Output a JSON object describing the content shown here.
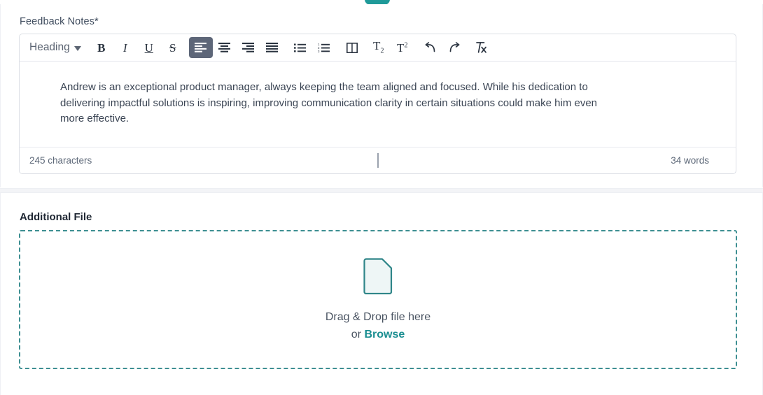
{
  "feedback_section": {
    "label": "Feedback Notes*",
    "toolbar": {
      "heading_label": "Heading",
      "caret_icon": "chevron-down-icon",
      "buttons": [
        {
          "name": "bold",
          "glyph": "B",
          "icon": "bold-icon"
        },
        {
          "name": "italic",
          "glyph": "I",
          "icon": "italic-icon"
        },
        {
          "name": "underline",
          "glyph": "U",
          "icon": "underline-icon"
        },
        {
          "name": "strikethrough",
          "glyph": "S",
          "icon": "strikethrough-icon"
        },
        {
          "name": "align-left",
          "glyph": "",
          "icon": "align-left-icon",
          "active": true
        },
        {
          "name": "align-center",
          "glyph": "",
          "icon": "align-center-icon"
        },
        {
          "name": "align-right",
          "glyph": "",
          "icon": "align-right-icon"
        },
        {
          "name": "align-justify",
          "glyph": "",
          "icon": "align-justify-icon"
        },
        {
          "name": "bullet-list",
          "glyph": "",
          "icon": "bulleted-list-icon"
        },
        {
          "name": "numbered-list",
          "glyph": "",
          "icon": "numbered-list-icon"
        },
        {
          "name": "columns",
          "glyph": "",
          "icon": "columns-icon"
        },
        {
          "name": "subscript",
          "glyph": "T2",
          "icon": "subscript-icon"
        },
        {
          "name": "superscript",
          "glyph": "T2",
          "icon": "superscript-icon"
        },
        {
          "name": "undo",
          "glyph": "",
          "icon": "undo-icon"
        },
        {
          "name": "redo",
          "glyph": "",
          "icon": "redo-icon"
        },
        {
          "name": "clear-format",
          "glyph": "",
          "icon": "clear-formatting-icon"
        }
      ]
    },
    "content": "Andrew is an exceptional product manager, always keeping the team aligned and focused. While his dedication to delivering impactful solutions is inspiring, improving communication clarity in certain situations could make him even more effective.",
    "character_count": "245 characters",
    "word_count": "34 words"
  },
  "upload_section": {
    "label": "Additional File",
    "file_icon": "document-file-icon",
    "drop_text": "Drag & Drop file here",
    "or_text": "or ",
    "browse_label": "Browse"
  },
  "colors": {
    "teal": "#1a8e91",
    "dashed_border": "#3d8f92",
    "active_button_bg": "#5d6678",
    "text_dark": "#3b4554",
    "label_gray": "#5d6878"
  }
}
